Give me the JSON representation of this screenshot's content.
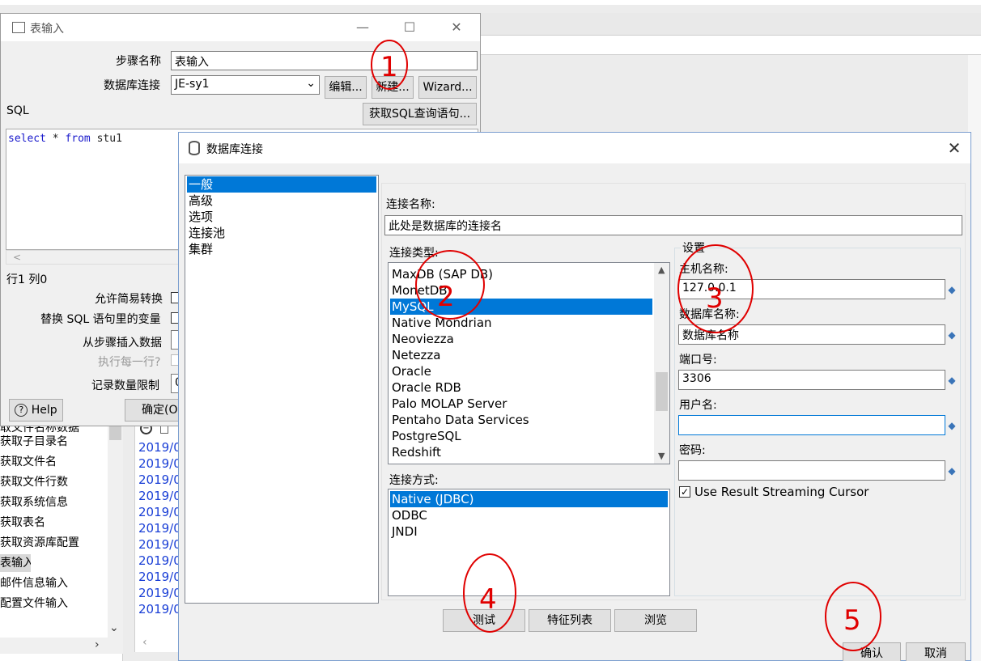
{
  "background": {
    "left_list_items": [
      "取文件名称数据",
      "获取子目录名",
      "获取文件名",
      "获取文件行数",
      "获取系统信息",
      "获取表名",
      "获取资源库配置",
      "表输入",
      "邮件信息输入",
      "配置文件输入"
    ],
    "log_items": [
      "2019/0",
      "2019/0",
      "2019/0",
      "2019/0",
      "2019/0",
      "2019/0",
      "2019/0",
      "2019/0",
      "2019/0",
      "2019/0",
      "2019/0"
    ]
  },
  "table_input": {
    "title": "表输入",
    "controls": {
      "minimize": "—",
      "maximize": "☐",
      "close": "✕"
    },
    "step_name_label": "步骤名称",
    "step_name_value": "表输入",
    "db_conn_label": "数据库连接",
    "db_conn_value": "JE-sy1",
    "edit_button": "编辑...",
    "new_button": "新建...",
    "wizard_button": "Wizard...",
    "sql_label": "SQL",
    "get_sql_button": "获取SQL查询语句...",
    "sql_keyword_select": "select",
    "sql_star": " * ",
    "sql_keyword_from": "from",
    "sql_table": " stu1",
    "scroll_left": "<",
    "cursor_position": "行1 列0",
    "allow_lazy_conversion_label": "允许简易转换",
    "replace_vars_label": "替换 SQL 语句里的变量",
    "insert_from_step_label": "从步骤插入数据",
    "execute_each_row_label": "执行每一行?",
    "limit_label": "记录数量限制",
    "limit_value": "0",
    "help_button": "Help",
    "ok_button": "确定(O"
  },
  "db_connection": {
    "title": "数据库连接",
    "close": "✕",
    "nav_items": [
      "一般",
      "高级",
      "选项",
      "连接池",
      "集群"
    ],
    "nav_selected": 0,
    "connection_name_label": "连接名称:",
    "connection_name_value": "此处是数据库的连接名",
    "connection_type_label": "连接类型:",
    "connection_types": [
      "MaxDB (SAP DB)",
      "MonetDB",
      "MySQL",
      "Native Mondrian",
      "Neoviezza",
      "Netezza",
      "Oracle",
      "Oracle RDB",
      "Palo MOLAP Server",
      "Pentaho Data Services",
      "PostgreSQL",
      "Redshift"
    ],
    "connection_type_selected": 2,
    "access_label": "连接方式:",
    "access_methods": [
      "Native (JDBC)",
      "ODBC",
      "JNDI"
    ],
    "access_selected": 0,
    "settings_label": "设置",
    "host_label": "主机名称:",
    "host_value": "127.0.0.1",
    "db_name_label": "数据库名称:",
    "db_name_value": "数据库名称",
    "port_label": "端口号:",
    "port_value": "3306",
    "user_label": "用户名:",
    "user_value": "",
    "password_label": "密码:",
    "password_value": "",
    "streaming_cursor_label": "Use Result Streaming Cursor",
    "streaming_cursor_checked": true,
    "test_button": "测试",
    "features_button": "特征列表",
    "explore_button": "浏览",
    "ok_button": "确认",
    "cancel_button": "取消"
  },
  "annotations": [
    "1",
    "2",
    "3",
    "4",
    "5"
  ]
}
